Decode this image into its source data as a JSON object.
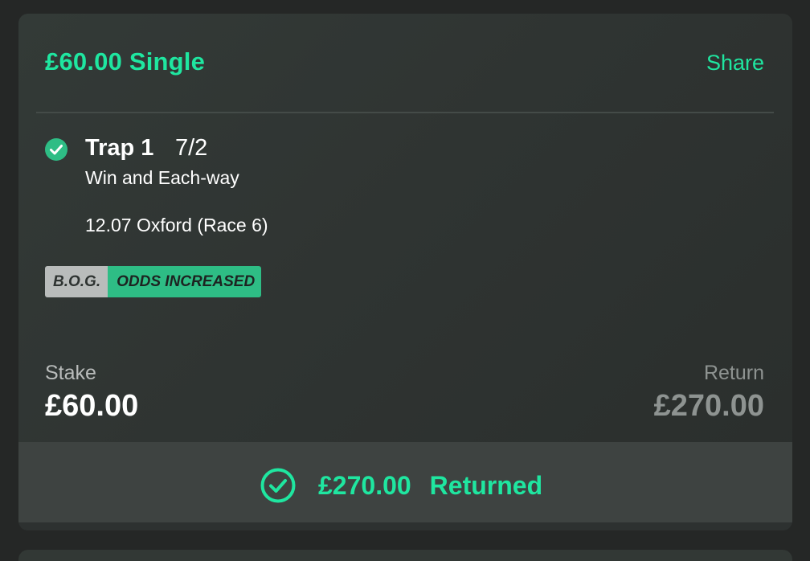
{
  "bet": {
    "title": "£60.00 Single",
    "share_label": "Share"
  },
  "selection": {
    "name": "Trap 1",
    "odds": "7/2",
    "bet_type": "Win and Each-way",
    "event": "12.07 Oxford (Race 6)",
    "status_icon": "check-circle-icon"
  },
  "badge": {
    "left": "B.O.G.",
    "right": "ODDS INCREASED"
  },
  "stake": {
    "label": "Stake",
    "value": "£60.00"
  },
  "return": {
    "label": "Return",
    "value": "£270.00"
  },
  "result": {
    "amount": "£270.00",
    "status": "Returned",
    "icon": "check-circle-outline-icon"
  },
  "colors": {
    "accent": "#1fe6a0",
    "badge_green": "#2ebd85",
    "badge_grey": "#b9bcbb",
    "background": "#252726"
  }
}
